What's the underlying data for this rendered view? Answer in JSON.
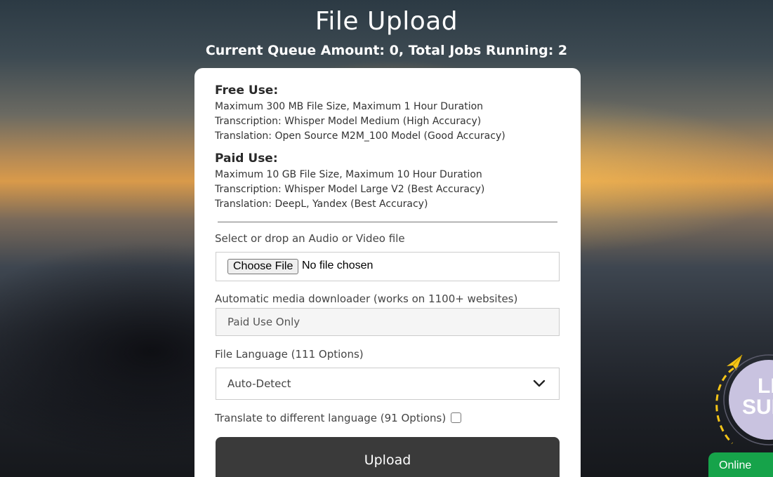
{
  "header": {
    "title": "File Upload",
    "queue_status": "Current Queue Amount: 0, Total Jobs Running: 2"
  },
  "free_use": {
    "title": "Free Use:",
    "lines": [
      "Maximum 300 MB File Size, Maximum 1 Hour Duration",
      "Transcription: Whisper Model Medium (High Accuracy)",
      "Translation: Open Source M2M_100 Model (Good Accuracy)"
    ]
  },
  "paid_use": {
    "title": "Paid Use:",
    "lines": [
      "Maximum 10 GB File Size, Maximum 10 Hour Duration",
      "Transcription: Whisper Model Large V2 (Best Accuracy)",
      "Translation: DeepL, Yandex (Best Accuracy)"
    ]
  },
  "file_input": {
    "label": "Select or drop an Audio or Video file",
    "button_label": "Choose File",
    "status": "No file chosen"
  },
  "downloader": {
    "label": "Automatic media downloader (works on 1100+ websites)",
    "placeholder": "Paid Use Only"
  },
  "language": {
    "label": "File Language (111 Options)",
    "selected": "Auto-Detect"
  },
  "translate": {
    "label": "Translate to different language (91 Options)",
    "checked": false
  },
  "upload_button": {
    "label": "Upload"
  },
  "live_support": {
    "text_line1": "LIVE",
    "text_line2": "SUPPORT",
    "icon": "paper-plane-icon",
    "accent_color": "#f5c518",
    "badge_color": "#c9c3e0"
  },
  "online_tab": {
    "label": "Online",
    "color": "#16a34a"
  }
}
